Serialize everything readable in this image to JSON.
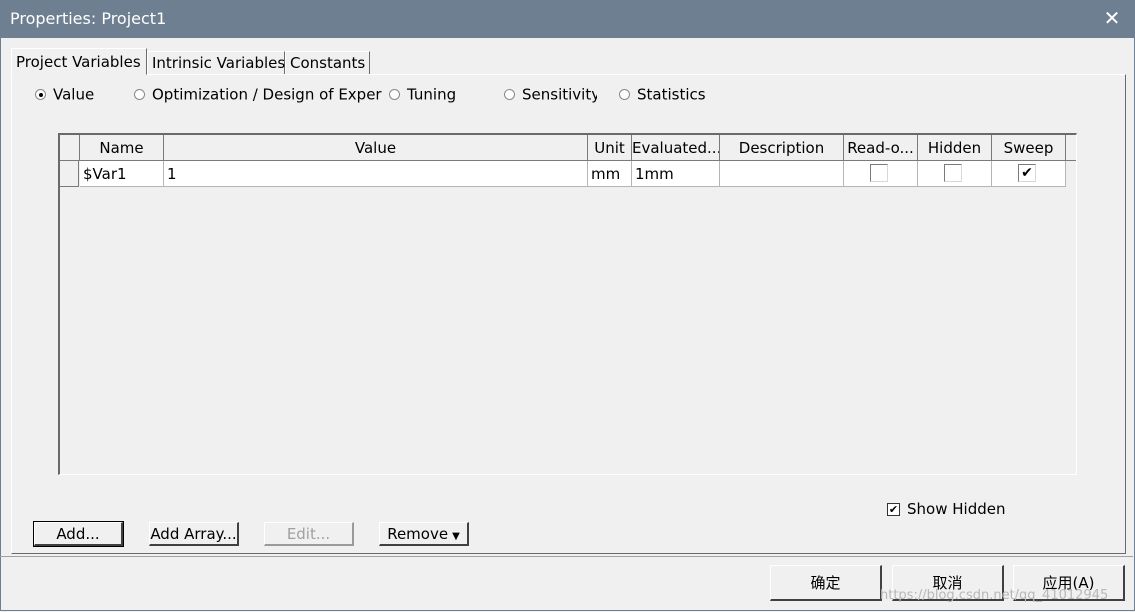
{
  "window": {
    "title": "Properties: Project1",
    "close_glyph": "✕"
  },
  "tabs": [
    "Project Variables",
    "Intrinsic Variables",
    "Constants"
  ],
  "radios": [
    "Value",
    "Optimization / Design of Exper",
    "Tuning",
    "Sensitivity",
    "Statistics"
  ],
  "selected_radio": "Value",
  "table": {
    "columns": [
      "Name",
      "Value",
      "Unit",
      "Evaluated...",
      "Description",
      "Read-o...",
      "Hidden",
      "Sweep"
    ],
    "rows": [
      {
        "name": "$Var1",
        "value": "1",
        "unit": "mm",
        "evaluated": "1mm",
        "description": "",
        "read_only": false,
        "hidden": false,
        "sweep": true
      }
    ]
  },
  "show_hidden": {
    "label": "Show Hidden",
    "checked": true
  },
  "buttons": {
    "add": "Add...",
    "add_array": "Add Array...",
    "edit": "Edit...",
    "remove": "Remove"
  },
  "dialog_buttons": {
    "ok": "确定",
    "cancel": "取消",
    "apply": "应用(A)"
  },
  "check_glyph": "✔",
  "watermark": "https://blog.csdn.net/qq_41012945"
}
